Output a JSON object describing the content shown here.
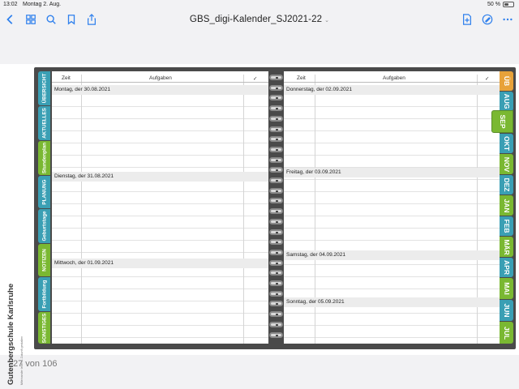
{
  "status": {
    "time": "13:02",
    "date": "Montag 2. Aug.",
    "battery_text": "50 %",
    "battery_level": 0.5
  },
  "toolbar": {
    "title": "GBS_digi-Kalender_SJ2021-22",
    "icons": [
      "back-icon",
      "grid-icon",
      "search-icon",
      "bookmark-icon",
      "share-icon",
      "new-page-icon",
      "markup-icon",
      "more-icon"
    ]
  },
  "school": {
    "name": "Gutenbergschule Karlsruhe",
    "subtitle": "Miteinander leben – Zukunft gestalten"
  },
  "planner": {
    "headers": {
      "time": "Zeit",
      "tasks": "Aufgaben",
      "check": "✓"
    },
    "left_days": [
      "Montag, der 30.08.2021",
      "Dienstag, der 31.08.2021",
      "Mittwoch, der 01.09.2021"
    ],
    "right_days": [
      "Donnerstag, der 02.09.2021",
      "Freitag, der 03.09.2021",
      "Samstag, der 04.09.2021",
      "Sonntag, der 05.09.2021"
    ]
  },
  "left_tabs": [
    {
      "label": "ÜBERSICHT",
      "color": "#3a9fb4"
    },
    {
      "label": "AKTUELLES",
      "color": "#3a9fb4"
    },
    {
      "label": "Stundenplan",
      "color": "#7ab832"
    },
    {
      "label": "PLANUNG",
      "color": "#3a9fb4"
    },
    {
      "label": "Geburtstage",
      "color": "#3a9fb4"
    },
    {
      "label": "NOTIZEN",
      "color": "#7ab832"
    },
    {
      "label": "Fortbildung",
      "color": "#3a9fb4"
    },
    {
      "label": "SONSTIGES",
      "color": "#7ab832"
    }
  ],
  "month_tabs": [
    {
      "label": "ÜB",
      "color": "#e8a23a"
    },
    {
      "label": "AUG",
      "color": "#3a9fb4"
    },
    {
      "label": "SEP",
      "color": "#7ab832",
      "active": true
    },
    {
      "label": "OKT",
      "color": "#3a9fb4"
    },
    {
      "label": "NOV",
      "color": "#7ab832"
    },
    {
      "label": "DEZ",
      "color": "#3a9fb4"
    },
    {
      "label": "JAN",
      "color": "#7ab832"
    },
    {
      "label": "FEB",
      "color": "#3a9fb4"
    },
    {
      "label": "MÄR",
      "color": "#7ab832"
    },
    {
      "label": "APR",
      "color": "#3a9fb4"
    },
    {
      "label": "MAI",
      "color": "#7ab832"
    },
    {
      "label": "JUN",
      "color": "#3a9fb4"
    },
    {
      "label": "JUL",
      "color": "#7ab832"
    }
  ],
  "footer": {
    "page_count": "27 von 106"
  }
}
